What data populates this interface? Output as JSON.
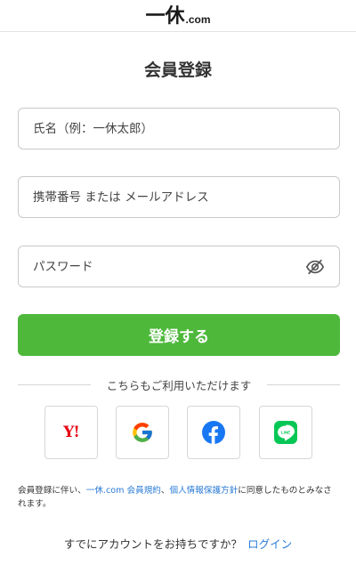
{
  "header": {
    "logo_kanji": "一休",
    "logo_suffix": ".com"
  },
  "page": {
    "title": "会員登録"
  },
  "form": {
    "name_placeholder": "氏名（例：一休太郎）",
    "contact_placeholder": "携帯番号 または メールアドレス",
    "password_placeholder": "パスワード",
    "submit_label": "登録する"
  },
  "social": {
    "divider_text": "こちらもご利用いただけます",
    "providers": [
      {
        "name": "Yahoo",
        "mark": "Y!",
        "color": "#e60012",
        "icon": "yahoo-icon"
      },
      {
        "name": "Google",
        "icon": "google-icon",
        "colors": [
          "#4285F4",
          "#EA4335",
          "#FBBC05",
          "#34A853"
        ]
      },
      {
        "name": "Facebook",
        "icon": "facebook-icon",
        "color": "#1877F2"
      },
      {
        "name": "LINE",
        "mark": "LINE",
        "color": "#06C755",
        "icon": "line-icon"
      }
    ]
  },
  "terms": {
    "prefix": "会員登録に伴い、",
    "link_terms": "一休.com 会員規約",
    "separator": "、",
    "link_privacy": "個人情報保護方針",
    "suffix": "に同意したものとみなされます。"
  },
  "login": {
    "question": "すでにアカウントをお持ちですか？",
    "link": "ログイン"
  },
  "colors": {
    "accent_green": "#4eb83b",
    "link_blue": "#2a7bd6"
  }
}
